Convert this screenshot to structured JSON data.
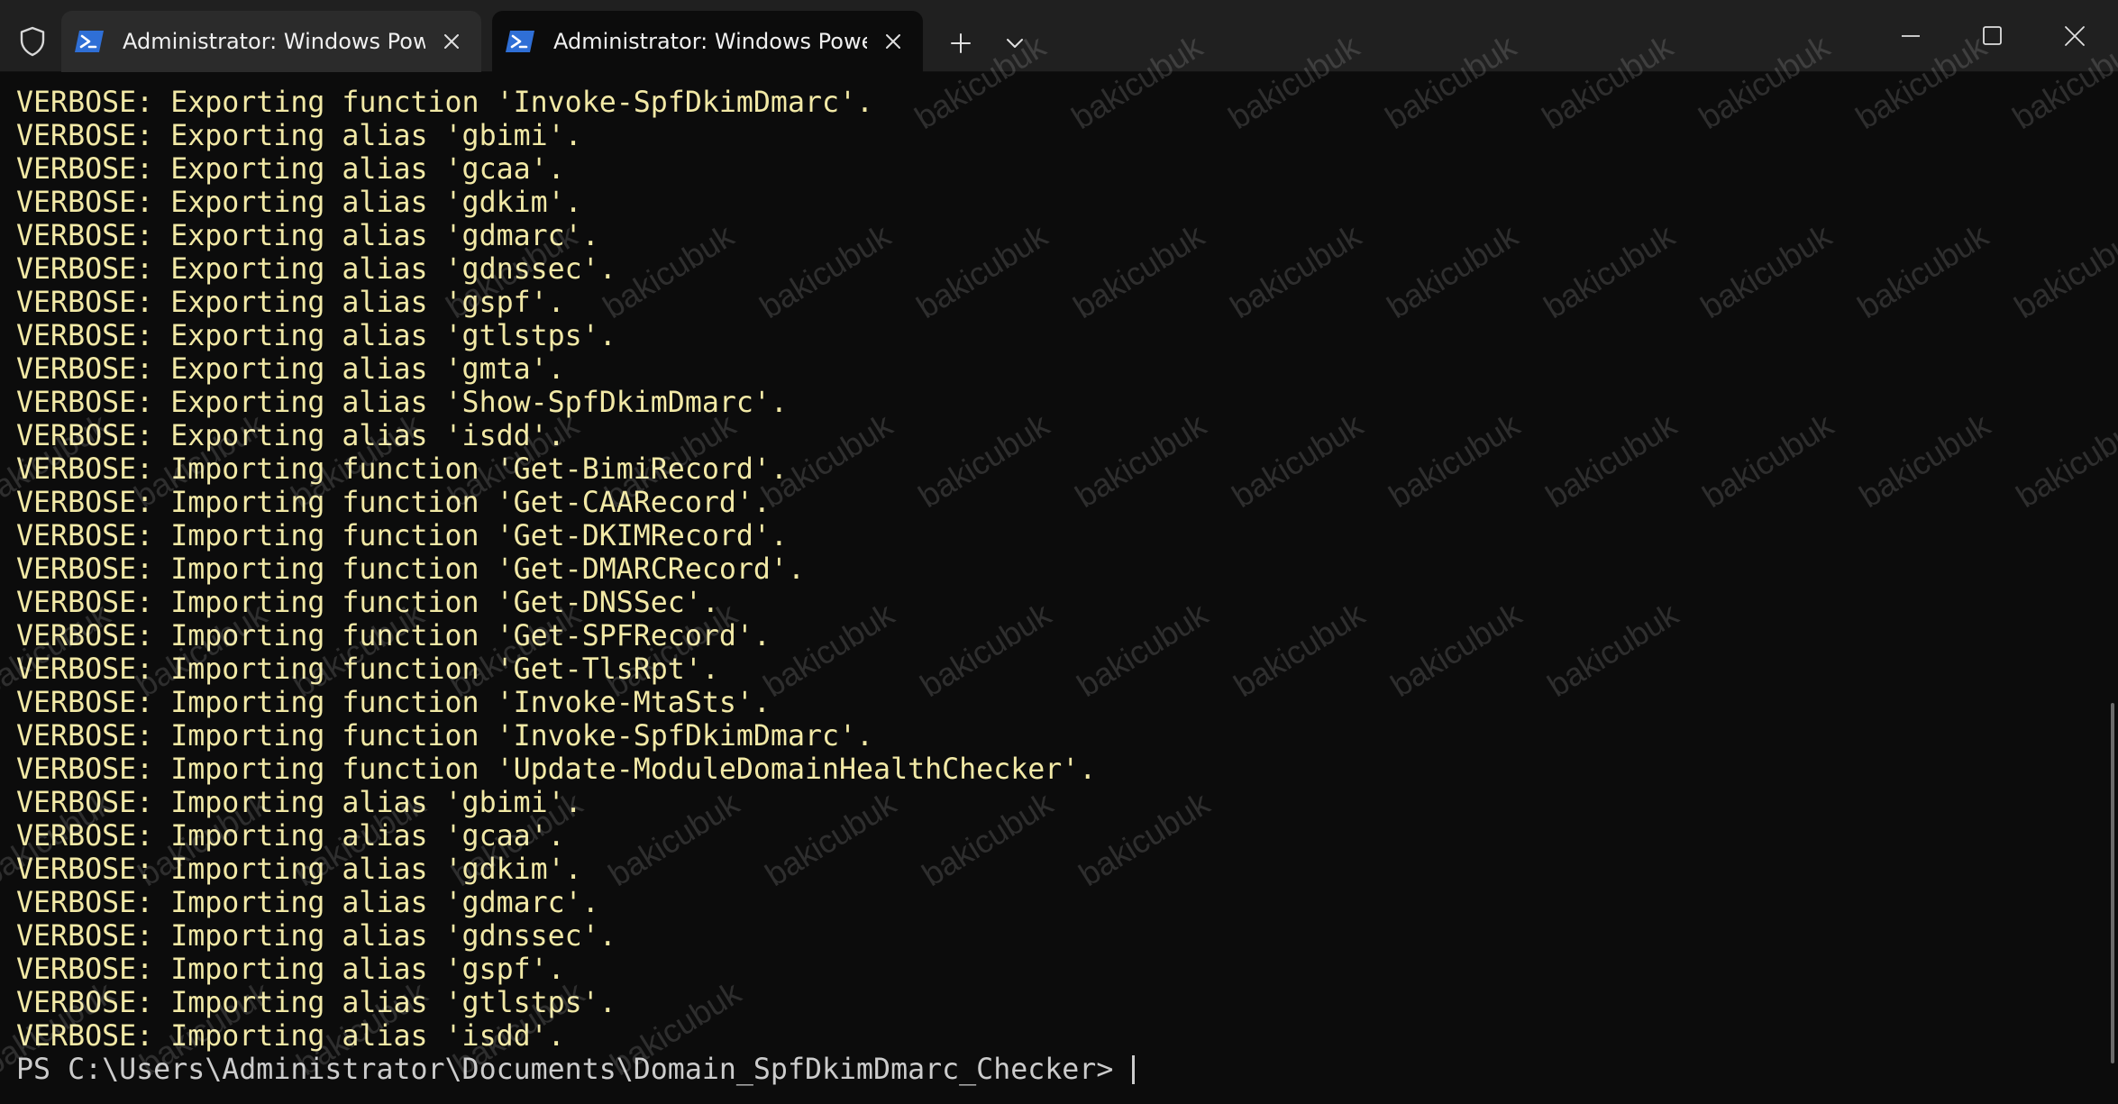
{
  "window": {
    "tabs": [
      {
        "title": "Administrator: Windows PowerShell",
        "active": false,
        "icon": "powershell-icon"
      },
      {
        "title": "Administrator: Windows PowerShell",
        "active": true,
        "icon": "powershell-icon"
      }
    ],
    "controls": [
      "minimize-icon",
      "maximize-icon",
      "close-icon"
    ]
  },
  "terminal": {
    "lines": [
      "VERBOSE: Exporting function 'Invoke-SpfDkimDmarc'.",
      "VERBOSE: Exporting alias 'gbimi'.",
      "VERBOSE: Exporting alias 'gcaa'.",
      "VERBOSE: Exporting alias 'gdkim'.",
      "VERBOSE: Exporting alias 'gdmarc'.",
      "VERBOSE: Exporting alias 'gdnssec'.",
      "VERBOSE: Exporting alias 'gspf'.",
      "VERBOSE: Exporting alias 'gtlstps'.",
      "VERBOSE: Exporting alias 'gmta'.",
      "VERBOSE: Exporting alias 'Show-SpfDkimDmarc'.",
      "VERBOSE: Exporting alias 'isdd'.",
      "VERBOSE: Importing function 'Get-BimiRecord'.",
      "VERBOSE: Importing function 'Get-CAARecord'.",
      "VERBOSE: Importing function 'Get-DKIMRecord'.",
      "VERBOSE: Importing function 'Get-DMARCRecord'.",
      "VERBOSE: Importing function 'Get-DNSSec'.",
      "VERBOSE: Importing function 'Get-SPFRecord'.",
      "VERBOSE: Importing function 'Get-TlsRpt'.",
      "VERBOSE: Importing function 'Invoke-MtaSts'.",
      "VERBOSE: Importing function 'Invoke-SpfDkimDmarc'.",
      "VERBOSE: Importing function 'Update-ModuleDomainHealthChecker'.",
      "VERBOSE: Importing alias 'gbimi'.",
      "VERBOSE: Importing alias 'gcaa'.",
      "VERBOSE: Importing alias 'gdkim'.",
      "VERBOSE: Importing alias 'gdmarc'.",
      "VERBOSE: Importing alias 'gdnssec'.",
      "VERBOSE: Importing alias 'gspf'.",
      "VERBOSE: Importing alias 'gtlstps'.",
      "VERBOSE: Importing alias 'isdd'."
    ],
    "prompt": "PS C:\\Users\\Administrator\\Documents\\Domain_SpfDkimDmarc_Checker> "
  },
  "watermark": "bakicubuk",
  "colors": {
    "background": "#0c0c0c",
    "verbose_text": "#f2e9a6",
    "prompt_text": "#cccccc",
    "titlebar": "#202020",
    "powershell_blue": "#2f6fd6"
  }
}
